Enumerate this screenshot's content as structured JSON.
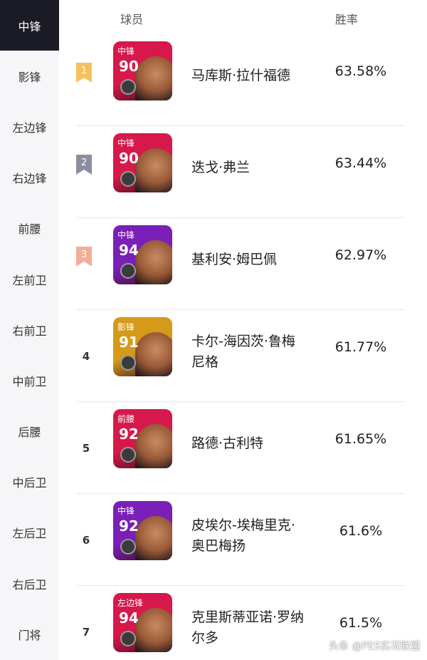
{
  "sidebar": {
    "items": [
      "中锋",
      "影锋",
      "左边锋",
      "右边锋",
      "前腰",
      "左前卫",
      "右前卫",
      "中前卫",
      "后腰",
      "中后卫",
      "左后卫",
      "右后卫",
      "门将"
    ],
    "active_index": 0
  },
  "header": {
    "player_label": "球员",
    "winrate_label": "胜率"
  },
  "rows": [
    {
      "rank": "1",
      "badge_color": "#f7c15a",
      "pos": "中锋",
      "rating": "90",
      "card_color": "#d7184a",
      "name": "马库斯·拉什福德",
      "winrate": "63.58%"
    },
    {
      "rank": "2",
      "badge_color": "#8a8ea0",
      "pos": "中锋",
      "rating": "90",
      "card_color": "#d7184a",
      "name": "迭戈·弗兰",
      "winrate": "63.44%"
    },
    {
      "rank": "3",
      "badge_color": "#f1ae98",
      "pos": "中锋",
      "rating": "94",
      "card_color": "#7a1fb8",
      "name": "基利安·姆巴佩",
      "winrate": "62.97%"
    },
    {
      "rank": "4",
      "badge_color": "",
      "pos": "影锋",
      "rating": "91",
      "card_color": "#d59a1a",
      "name": "卡尔-海因茨·鲁梅尼格",
      "winrate": "61.77%"
    },
    {
      "rank": "5",
      "badge_color": "",
      "pos": "前腰",
      "rating": "92",
      "card_color": "#d7184a",
      "name": "路德·古利特",
      "winrate": "61.65%"
    },
    {
      "rank": "6",
      "badge_color": "",
      "pos": "中锋",
      "rating": "92",
      "card_color": "#7a1fb8",
      "name": "皮埃尔-埃梅里克·奥巴梅扬",
      "winrate": "61.6%"
    },
    {
      "rank": "7",
      "badge_color": "",
      "pos": "左边锋",
      "rating": "94",
      "card_color": "#d7184a",
      "name": "克里斯蒂亚诺·罗纳尔多",
      "winrate": "61.5%"
    }
  ],
  "watermark": "头条 @PES实况联盟"
}
